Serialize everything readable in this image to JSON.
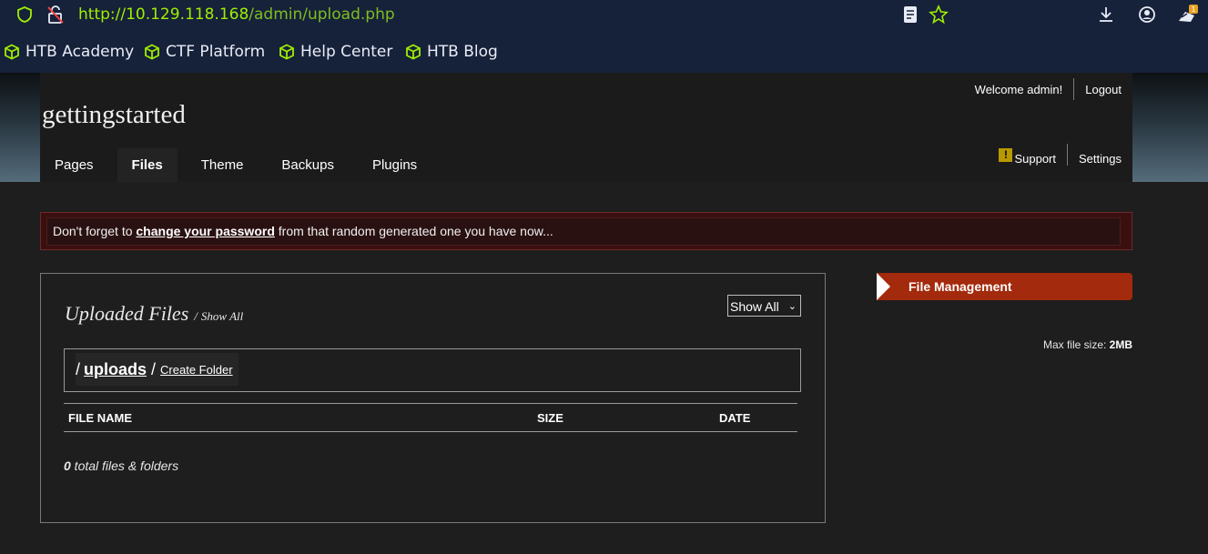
{
  "browser": {
    "url_host": "http://10.129.118.168",
    "url_path": "/admin/upload.php",
    "bookmarks": [
      "HTB Academy",
      "CTF Platform",
      "Help Center",
      "HTB Blog"
    ],
    "download_badge": "1",
    "accent_color": "#9fef00"
  },
  "header": {
    "site_title": "gettingstarted",
    "welcome": "Welcome admin!",
    "logout": "Logout",
    "support": "Support",
    "settings": "Settings",
    "warn_glyph": "!",
    "tabs": [
      "Pages",
      "Files",
      "Theme",
      "Backups",
      "Plugins"
    ],
    "active_tab": "Files"
  },
  "notice": {
    "before": "Don't forget to ",
    "link": "change your password",
    "after": " from that random generated one you have now..."
  },
  "files": {
    "title": "Uploaded Files",
    "slash": "/",
    "show_all_link": "Show All",
    "filter_value": "Show All",
    "path_prefix": "/",
    "folder": "uploads",
    "path_sep": "/",
    "create_folder": "Create Folder",
    "columns": [
      "FILE NAME",
      "SIZE",
      "DATE"
    ],
    "count": "0",
    "count_suffix": " total files & folders"
  },
  "sidebar": {
    "file_management": "File Management",
    "max_label": "Max file size: ",
    "max_value": "2MB",
    "accent_color": "#a32a0c"
  }
}
